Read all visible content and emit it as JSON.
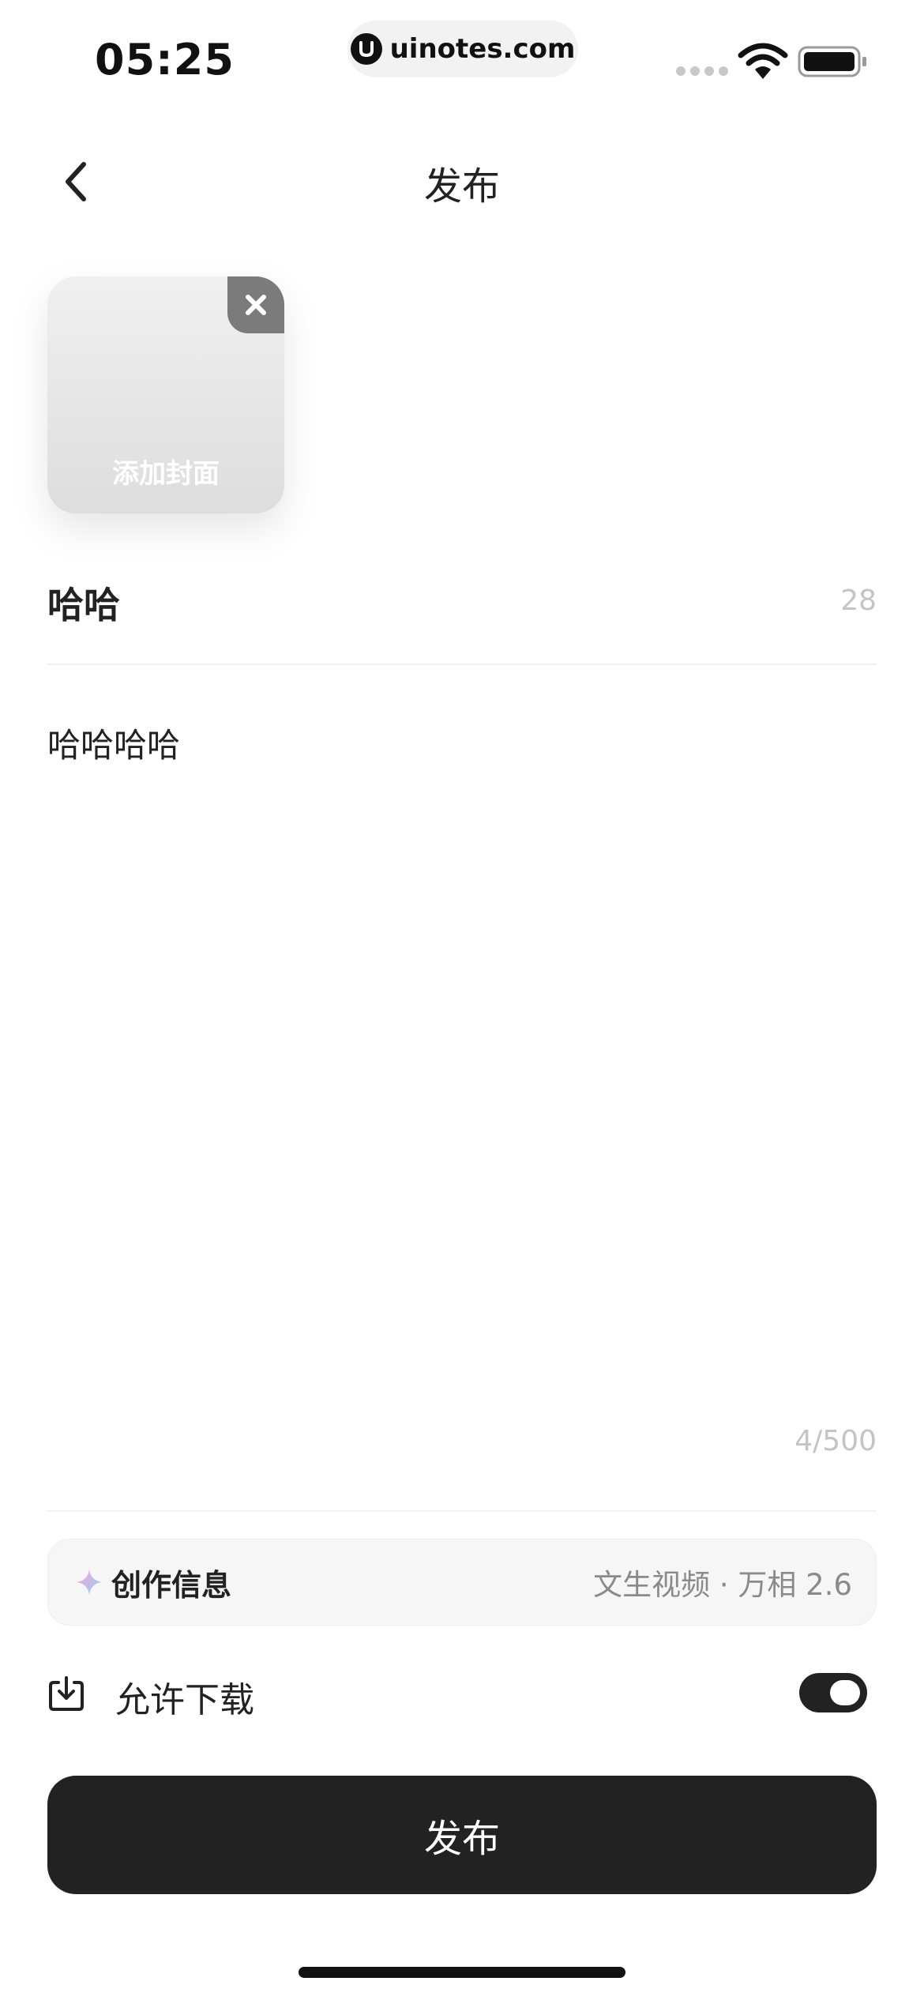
{
  "status_bar": {
    "time": "05:25",
    "url": "uinotes.com"
  },
  "nav": {
    "title": "发布",
    "back_icon": "chevron-left-icon"
  },
  "cover": {
    "label": "添加封面",
    "close_icon": "close-icon"
  },
  "title_field": {
    "value": "哈哈",
    "counter": "28"
  },
  "body_field": {
    "value": "哈哈哈哈",
    "counter": "4/500"
  },
  "creation_info": {
    "icon": "sparkle-icon",
    "label": "创作信息",
    "value": "文生视频 · 万相 2.6"
  },
  "download": {
    "icon": "download-icon",
    "label": "允许下载",
    "enabled": true
  },
  "publish_button": {
    "label": "发布"
  },
  "colors": {
    "primary": "#222222",
    "muted_text": "#8a8a8a",
    "counter_text": "#c4c4c4",
    "card_background": "#f6f6f6"
  }
}
